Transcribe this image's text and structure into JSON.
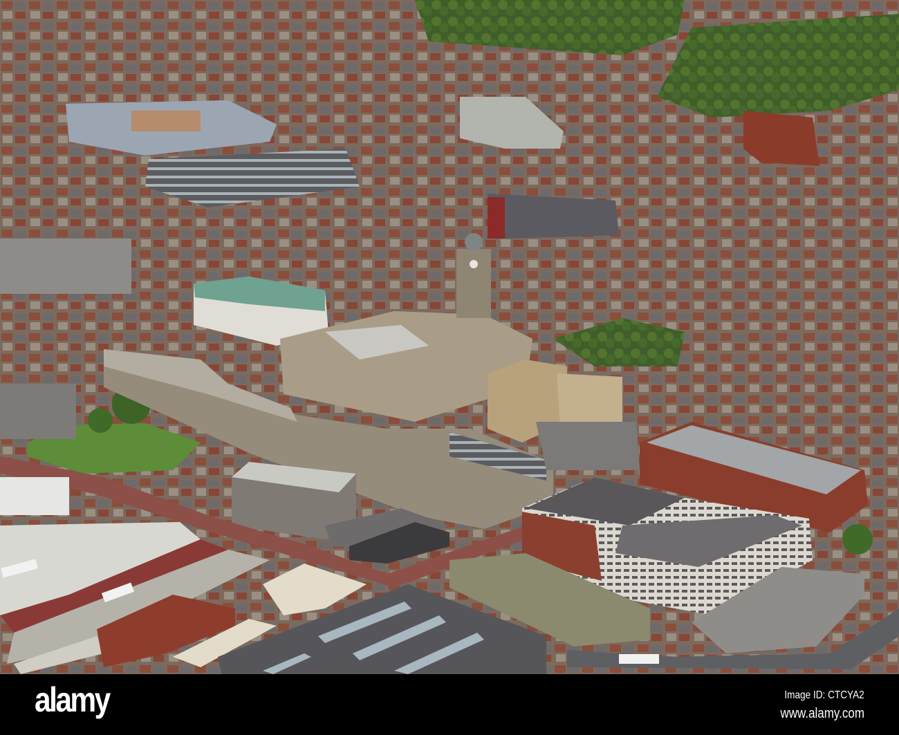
{
  "photo": {
    "subject": "aerial-town-centre"
  },
  "footer": {
    "logo_text": "alamy",
    "image_id": "Image ID: CTCYA2",
    "url": "www.alamy.com"
  }
}
